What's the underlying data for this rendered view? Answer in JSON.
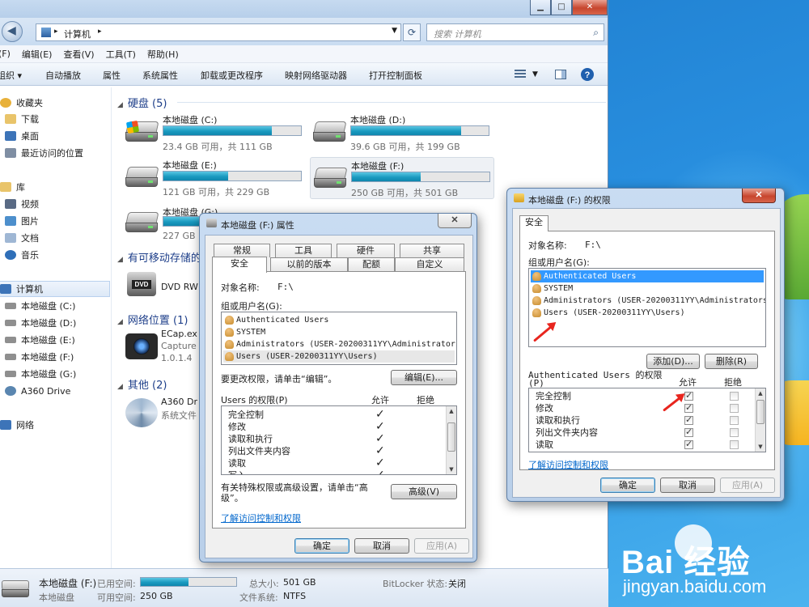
{
  "explorer": {
    "caption_buttons": [
      "▁",
      "□",
      "✕"
    ],
    "address": {
      "path": "计算机",
      "search_placeholder": "搜索 计算机"
    },
    "menu": [
      "(F)",
      "编辑(E)",
      "查看(V)",
      "工具(T)",
      "帮助(H)"
    ],
    "toolbar": [
      "组织 ▾",
      "自动播放",
      "属性",
      "系统属性",
      "卸载或更改程序",
      "映射网络驱动器",
      "打开控制面板"
    ],
    "nav": [
      {
        "label": "收藏夹",
        "icon": "star-icon",
        "color": "#e8b13a"
      },
      {
        "label": "下载",
        "icon": "folder-icon",
        "color": "#e9c46a"
      },
      {
        "label": "桌面",
        "icon": "desktop-icon",
        "color": "#3d74b8"
      },
      {
        "label": "最近访问的位置",
        "icon": "recent-icon",
        "color": "#7f8ea3"
      },
      {
        "label": "库",
        "icon": "library-icon",
        "color": "#e9c46a"
      },
      {
        "label": "视频",
        "icon": "video-icon",
        "color": "#596a84"
      },
      {
        "label": "图片",
        "icon": "picture-icon",
        "color": "#4d8fcc"
      },
      {
        "label": "文档",
        "icon": "document-icon",
        "color": "#9fb7d4"
      },
      {
        "label": "音乐",
        "icon": "music-icon",
        "color": "#2f6fb8"
      },
      {
        "label": "计算机",
        "icon": "computer-icon",
        "color": "#3d74b8"
      },
      {
        "label": "本地磁盘 (C:)",
        "icon": "drive-icon",
        "color": "#8f8f8f"
      },
      {
        "label": "本地磁盘 (D:)",
        "icon": "drive-icon",
        "color": "#8f8f8f"
      },
      {
        "label": "本地磁盘 (E:)",
        "icon": "drive-icon",
        "color": "#8f8f8f"
      },
      {
        "label": "本地磁盘 (F:)",
        "icon": "drive-icon",
        "color": "#8f8f8f"
      },
      {
        "label": "本地磁盘 (G:)",
        "icon": "drive-icon",
        "color": "#8f8f8f"
      },
      {
        "label": "A360 Drive",
        "icon": "a360-icon",
        "color": "#5a86b0"
      },
      {
        "label": "网络",
        "icon": "network-icon",
        "color": "#3d74b8"
      }
    ],
    "groups": {
      "hdd": "硬盘 (5)",
      "removable": "有可移动存储的",
      "network": "网络位置 (1)",
      "other": "其他 (2)"
    },
    "drives": [
      {
        "name": "本地磁盘 (C:)",
        "info": "23.4 GB 可用，共 111 GB",
        "used": 0.79,
        "system": true
      },
      {
        "name": "本地磁盘 (D:)",
        "info": "39.6 GB 可用，共 199 GB",
        "used": 0.8,
        "system": false
      },
      {
        "name": "本地磁盘 (E:)",
        "info": "121 GB 可用，共 229 GB",
        "used": 0.47,
        "system": false
      },
      {
        "name": "本地磁盘 (F:)",
        "info": "250 GB 可用，共 501 GB",
        "used": 0.5,
        "system": false
      },
      {
        "name": "本地磁盘 (G:)",
        "info": "227 GB",
        "used": 0.3,
        "system": false
      }
    ],
    "dvd": {
      "name": "DVD RW"
    },
    "network_item": {
      "name": "ECap.ex",
      "line2": "Capture",
      "line3": "1.0.1.4"
    },
    "other_item": {
      "name": "A360 Dr",
      "line2": "系统文件"
    },
    "details": {
      "name": "本地磁盘 (F:)",
      "type": "本地磁盘",
      "used_label": "已用空间:",
      "free_label": "可用空间:",
      "free": "250 GB",
      "total_label": "总大小:",
      "total": "501 GB",
      "fs_label": "文件系统:",
      "fs": "NTFS",
      "bitlocker_label": "BitLocker 状态:",
      "bitlocker": "关闭",
      "used_fraction": 0.5
    }
  },
  "props": {
    "title": "本地磁盘 (F:) 属性",
    "close": "✕",
    "tabs_row1": [
      "常规",
      "工具",
      "硬件",
      "共享"
    ],
    "tabs_row2": [
      "安全",
      "以前的版本",
      "配额",
      "自定义"
    ],
    "object_label": "对象名称:",
    "object_value": "F:\\",
    "group_label": "组或用户名(G):",
    "users": [
      "Authenticated Users",
      "SYSTEM",
      "Administrators (USER-20200311YY\\Administrators)",
      "Users (USER-20200311YY\\Users)"
    ],
    "edit_hint": "要更改权限，请单击“编辑”。",
    "edit_btn": "编辑(E)...",
    "perm_header": "Users 的权限(P)",
    "allow": "允许",
    "deny": "拒绝",
    "perms": [
      "完全控制",
      "修改",
      "读取和执行",
      "列出文件夹内容",
      "读取",
      "写入"
    ],
    "perm_allow": [
      false,
      false,
      true,
      true,
      true,
      true
    ],
    "adv_hint": "有关特殊权限或高级设置，请单击“高级”。",
    "adv_btn": "高级(V)",
    "link": "了解访问控制和权限",
    "ok": "确定",
    "cancel": "取消",
    "apply": "应用(A)"
  },
  "perm": {
    "title": "本地磁盘 (F:) 的权限",
    "close": "✕",
    "tab": "安全",
    "object_label": "对象名称:",
    "object_value": "F:\\",
    "group_label": "组或用户名(G):",
    "users": [
      "Authenticated Users",
      "SYSTEM",
      "Administrators (USER-20200311YY\\Administrators)",
      "Users (USER-20200311YY\\Users)"
    ],
    "add_btn": "添加(D)...",
    "remove_btn": "删除(R)",
    "perm_header": "Authenticated Users 的权限",
    "perm_header2": "(P)",
    "allow": "允许",
    "deny": "拒绝",
    "perms": [
      "完全控制",
      "修改",
      "读取和执行",
      "列出文件夹内容",
      "读取"
    ],
    "perm_allow": [
      true,
      true,
      true,
      true,
      true
    ],
    "link": "了解访问控制和权限",
    "ok": "确定",
    "cancel": "取消",
    "apply": "应用(A)"
  },
  "watermark": {
    "brand": "Bai 经验",
    "url": "jingyan.baidu.com"
  }
}
